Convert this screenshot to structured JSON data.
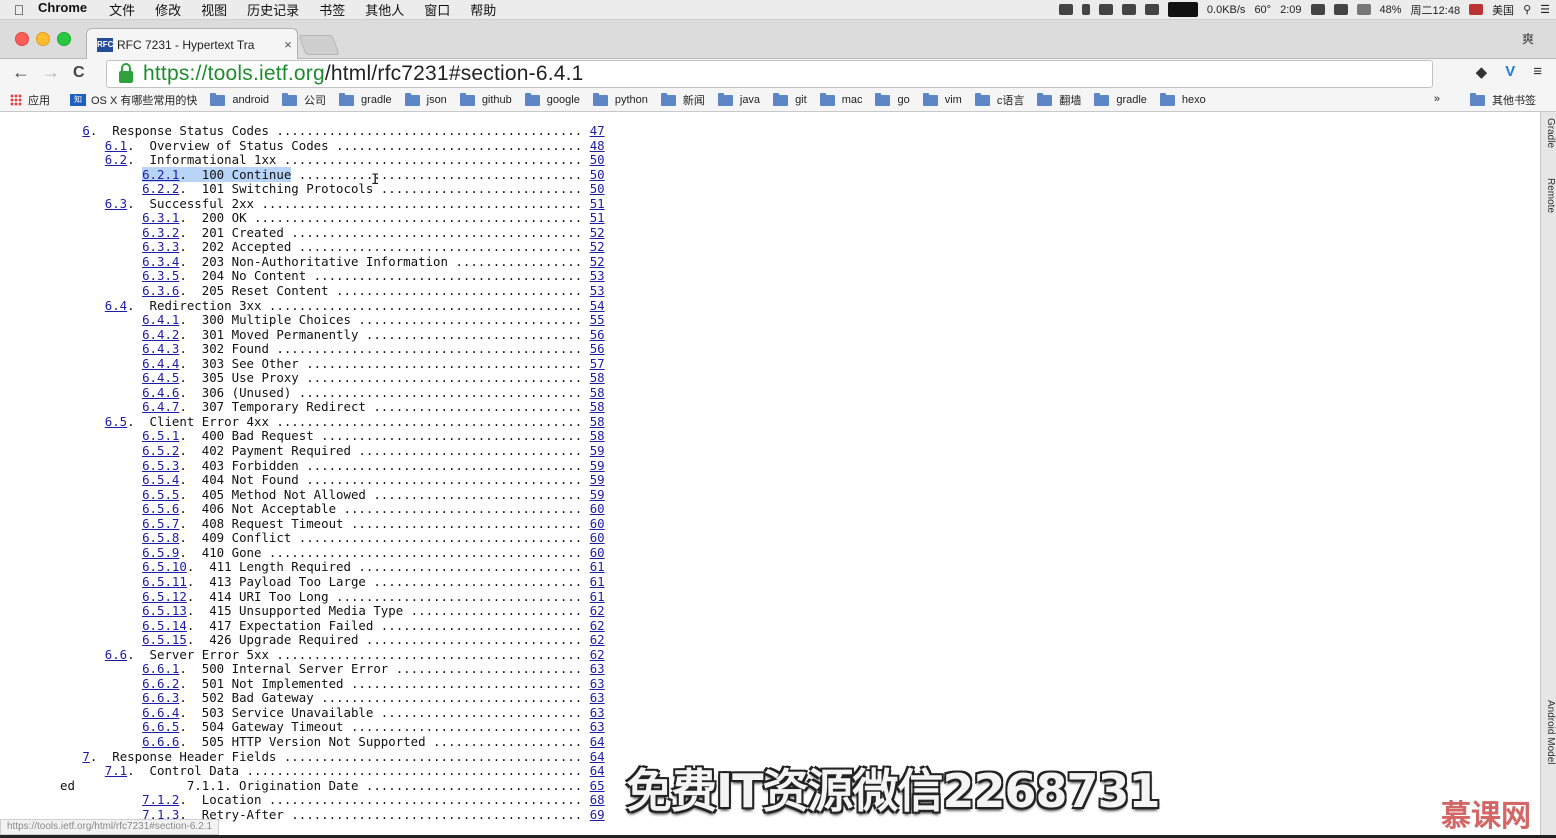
{
  "menubar": {
    "apple": "",
    "items": [
      "Chrome",
      "文件",
      "修改",
      "视图",
      "历史记录",
      "书签",
      "其他人",
      "窗口",
      "帮助"
    ],
    "status": {
      "net_speed": "0.0KB/s",
      "temp": "60°",
      "battery_timer": "2:09",
      "battery": "48%",
      "clock": "周二12:48",
      "input": "美国"
    }
  },
  "tab": {
    "favicon_text": "RFC",
    "title": "RFC 7231 - Hypertext Tra",
    "close": "×"
  },
  "profile_button": "爽",
  "toolbar": {
    "back": "←",
    "forward": "→",
    "reload": "C",
    "url_scheme_host": "https://tools.ietf.org",
    "url_path": "/html/rfc7231#section-6.4.1",
    "right_icons": [
      "translate-icon",
      "vimium-icon",
      "menu-icon"
    ],
    "menu": "≡"
  },
  "bookmarks": {
    "apps": "应用",
    "items": [
      {
        "label": "OS X 有哪些常用的快",
        "type": "site"
      },
      {
        "label": "android",
        "type": "folder"
      },
      {
        "label": "公司",
        "type": "folder"
      },
      {
        "label": "gradle",
        "type": "folder"
      },
      {
        "label": "json",
        "type": "folder"
      },
      {
        "label": "github",
        "type": "folder"
      },
      {
        "label": "google",
        "type": "folder"
      },
      {
        "label": "python",
        "type": "folder"
      },
      {
        "label": "新闻",
        "type": "folder"
      },
      {
        "label": "java",
        "type": "folder"
      },
      {
        "label": "git",
        "type": "folder"
      },
      {
        "label": "mac",
        "type": "folder"
      },
      {
        "label": "go",
        "type": "folder"
      },
      {
        "label": "vim",
        "type": "folder"
      },
      {
        "label": "c语言",
        "type": "folder"
      },
      {
        "label": "翻墙",
        "type": "folder"
      },
      {
        "label": "gradle",
        "type": "folder"
      },
      {
        "label": "hexo",
        "type": "folder"
      }
    ],
    "more": "»",
    "other": "其他书签"
  },
  "toc": [
    {
      "pre": "   ",
      "num": "6",
      "title": "Response Status Codes",
      "page": "47"
    },
    {
      "pre": "      ",
      "num": "6.1",
      "title": "Overview of Status Codes",
      "page": "48"
    },
    {
      "pre": "      ",
      "num": "6.2",
      "title": "Informational 1xx",
      "page": "50"
    },
    {
      "pre": "           ",
      "num": "6.2.1",
      "title": "100 Continue",
      "page": "50",
      "highlight": true
    },
    {
      "pre": "           ",
      "num": "6.2.2",
      "title": "101 Switching Protocols",
      "page": "50"
    },
    {
      "pre": "      ",
      "num": "6.3",
      "title": "Successful 2xx",
      "page": "51"
    },
    {
      "pre": "           ",
      "num": "6.3.1",
      "title": "200 OK",
      "page": "51"
    },
    {
      "pre": "           ",
      "num": "6.3.2",
      "title": "201 Created",
      "page": "52"
    },
    {
      "pre": "           ",
      "num": "6.3.3",
      "title": "202 Accepted",
      "page": "52"
    },
    {
      "pre": "           ",
      "num": "6.3.4",
      "title": "203 Non-Authoritative Information",
      "page": "52"
    },
    {
      "pre": "           ",
      "num": "6.3.5",
      "title": "204 No Content",
      "page": "53"
    },
    {
      "pre": "           ",
      "num": "6.3.6",
      "title": "205 Reset Content",
      "page": "53"
    },
    {
      "pre": "      ",
      "num": "6.4",
      "title": "Redirection 3xx",
      "page": "54"
    },
    {
      "pre": "           ",
      "num": "6.4.1",
      "title": "300 Multiple Choices",
      "page": "55"
    },
    {
      "pre": "           ",
      "num": "6.4.2",
      "title": "301 Moved Permanently",
      "page": "56"
    },
    {
      "pre": "           ",
      "num": "6.4.3",
      "title": "302 Found",
      "page": "56"
    },
    {
      "pre": "           ",
      "num": "6.4.4",
      "title": "303 See Other",
      "page": "57"
    },
    {
      "pre": "           ",
      "num": "6.4.5",
      "title": "305 Use Proxy",
      "page": "58"
    },
    {
      "pre": "           ",
      "num": "6.4.6",
      "title": "306 (Unused)",
      "page": "58"
    },
    {
      "pre": "           ",
      "num": "6.4.7",
      "title": "307 Temporary Redirect",
      "page": "58"
    },
    {
      "pre": "      ",
      "num": "6.5",
      "title": "Client Error 4xx",
      "page": "58"
    },
    {
      "pre": "           ",
      "num": "6.5.1",
      "title": "400 Bad Request",
      "page": "58"
    },
    {
      "pre": "           ",
      "num": "6.5.2",
      "title": "402 Payment Required",
      "page": "59"
    },
    {
      "pre": "           ",
      "num": "6.5.3",
      "title": "403 Forbidden",
      "page": "59"
    },
    {
      "pre": "           ",
      "num": "6.5.4",
      "title": "404 Not Found",
      "page": "59"
    },
    {
      "pre": "           ",
      "num": "6.5.5",
      "title": "405 Method Not Allowed",
      "page": "59"
    },
    {
      "pre": "           ",
      "num": "6.5.6",
      "title": "406 Not Acceptable",
      "page": "60"
    },
    {
      "pre": "           ",
      "num": "6.5.7",
      "title": "408 Request Timeout",
      "page": "60"
    },
    {
      "pre": "           ",
      "num": "6.5.8",
      "title": "409 Conflict",
      "page": "60"
    },
    {
      "pre": "           ",
      "num": "6.5.9",
      "title": "410 Gone",
      "page": "60"
    },
    {
      "pre": "           ",
      "num": "6.5.10",
      "title": "411 Length Required",
      "page": "61"
    },
    {
      "pre": "           ",
      "num": "6.5.11",
      "title": "413 Payload Too Large",
      "page": "61"
    },
    {
      "pre": "           ",
      "num": "6.5.12",
      "title": "414 URI Too Long",
      "page": "61"
    },
    {
      "pre": "           ",
      "num": "6.5.13",
      "title": "415 Unsupported Media Type",
      "page": "62"
    },
    {
      "pre": "           ",
      "num": "6.5.14",
      "title": "417 Expectation Failed",
      "page": "62"
    },
    {
      "pre": "           ",
      "num": "6.5.15",
      "title": "426 Upgrade Required",
      "page": "62"
    },
    {
      "pre": "      ",
      "num": "6.6",
      "title": "Server Error 5xx",
      "page": "62"
    },
    {
      "pre": "           ",
      "num": "6.6.1",
      "title": "500 Internal Server Error",
      "page": "63"
    },
    {
      "pre": "           ",
      "num": "6.6.2",
      "title": "501 Not Implemented",
      "page": "63"
    },
    {
      "pre": "           ",
      "num": "6.6.3",
      "title": "502 Bad Gateway",
      "page": "63"
    },
    {
      "pre": "           ",
      "num": "6.6.4",
      "title": "503 Service Unavailable",
      "page": "63"
    },
    {
      "pre": "           ",
      "num": "6.6.5",
      "title": "504 Gateway Timeout",
      "page": "63"
    },
    {
      "pre": "           ",
      "num": "6.6.6",
      "title": "505 HTTP Version Not Supported",
      "page": "64"
    },
    {
      "pre": "   ",
      "num": "7",
      "title": "Response Header Fields",
      "page": "64"
    },
    {
      "pre": "      ",
      "num": "7.1",
      "title": "Control Data",
      "page": "64"
    },
    {
      "pre": "ed               ",
      "num": "",
      "title": "7.1.1. Origination Date",
      "page": "65",
      "plain": true
    },
    {
      "pre": "           ",
      "num": "7.1.2",
      "title": "Location",
      "page": "68"
    },
    {
      "pre": "           ",
      "num": "7.1.3",
      "title": "Retry-After",
      "page": "69"
    }
  ],
  "cursor_glyph": "I",
  "watermark": "免费IT资源微信2268731",
  "corner_logo": "慕课网",
  "status_url": "https://tools.ietf.org/html/rfc7231#section-6.2.1",
  "side_labels": [
    "Gradle",
    "Remote",
    "Android Model"
  ],
  "colors": {
    "link": "#1c1ca8",
    "url_green": "#1e8c2e",
    "selection": "#b8d4f6"
  }
}
